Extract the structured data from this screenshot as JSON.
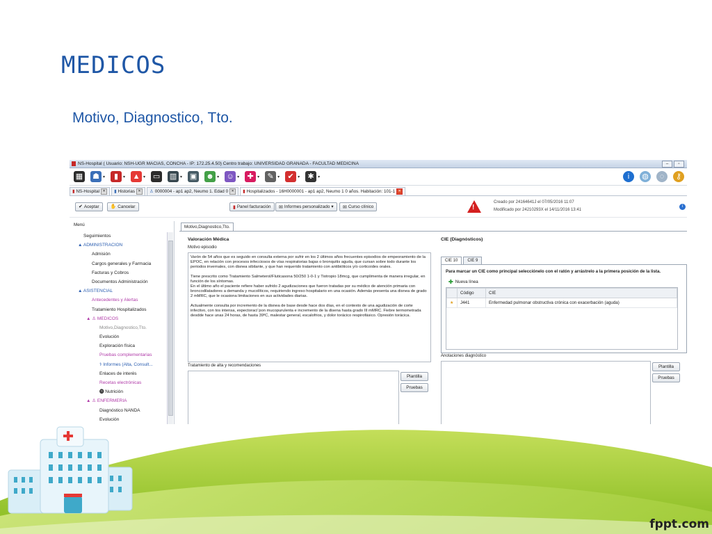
{
  "slide": {
    "title": "MEDICOS",
    "subtitle": "Motivo, Diagnostico, Tto.",
    "footer_logo": "fppt.com"
  },
  "window": {
    "title": "NS-Hospital  ( Usuario: NSH-UGR MACIAS, CONCHA - IP: 172.25.4.50)     Centro trabajo: UNIVERSIDAD GRANADA - FACULTAD MEDICINA",
    "buttons": [
      "‒",
      "▫"
    ]
  },
  "toolbar": {
    "icons": [
      {
        "name": "calendar-icon",
        "glyph": "▦",
        "color": "#2b2b2b"
      },
      {
        "name": "patients-icon",
        "glyph": "☗",
        "color": "#3a6fb8"
      },
      {
        "name": "briefcase-icon",
        "glyph": "▮",
        "color": "#c62828"
      },
      {
        "name": "alarm-icon",
        "glyph": "▲",
        "color": "#e53935"
      },
      {
        "name": "bed-icon",
        "glyph": "▭",
        "color": "#2b2b2b"
      },
      {
        "name": "lab-icon",
        "glyph": "▥",
        "color": "#37474f"
      },
      {
        "name": "hospital-icon",
        "glyph": "▣",
        "color": "#455a64"
      },
      {
        "name": "doctor-icon",
        "glyph": "☻",
        "color": "#43a047"
      },
      {
        "name": "nurse-icon",
        "glyph": "☺",
        "color": "#7e57c2"
      },
      {
        "name": "pharmacy-icon",
        "glyph": "✚",
        "color": "#d81b60"
      },
      {
        "name": "pen-icon",
        "glyph": "✎",
        "color": "#616161"
      },
      {
        "name": "check-icon",
        "glyph": "✔",
        "color": "#d32f2f"
      },
      {
        "name": "settings-icon",
        "glyph": "✱",
        "color": "#333333"
      }
    ],
    "right_icons": [
      {
        "name": "info-icon",
        "glyph": "i",
        "color": "#1e6fd0"
      },
      {
        "name": "search-icon",
        "glyph": "◍",
        "color": "#7fb0d8"
      },
      {
        "name": "chat-icon",
        "glyph": "◌",
        "color": "#a0b4c8"
      },
      {
        "name": "key-icon",
        "glyph": "⚷",
        "color": "#e0a020"
      }
    ]
  },
  "tabs": [
    {
      "label": "NS-Hospital",
      "active": false
    },
    {
      "label": "Historias",
      "active": false
    },
    {
      "label": "0000004 - ap1 ap2, Neumo 1. Edad 0",
      "active": false
    },
    {
      "label": "Hospitalizados - 16H0000001 - ap1 ap2, Neumo 1 0 años. Habitación: 101-1",
      "active": true
    }
  ],
  "actions": {
    "accept": "Aceptar",
    "cancel": "Cancelar",
    "billing": "Panel facturación",
    "reports": "Informes personalizado",
    "course": "Curso clínico",
    "created": "Creado por 24164641J el 07/05/2016 11:07",
    "modified": "Modificado por 24210293X el 14/11/2016 13:41"
  },
  "sidebar": {
    "label": "Menú",
    "items": [
      {
        "label": "Seguimientos",
        "level": "l0",
        "style": ""
      },
      {
        "label": "▲ ADMINISTRACION",
        "level": "l0g",
        "style": "blue"
      },
      {
        "label": "Admisión",
        "level": "l1",
        "style": ""
      },
      {
        "label": "Cargos generales y Farmacia",
        "level": "l1",
        "style": ""
      },
      {
        "label": "Facturas y Cobros",
        "level": "l1",
        "style": ""
      },
      {
        "label": "Documentos Administración",
        "level": "l1",
        "style": ""
      },
      {
        "label": "▲ ASISTENCIAL",
        "level": "l0g",
        "style": "blue"
      },
      {
        "label": "Antecedentes y Alertas",
        "level": "l1",
        "style": "magenta"
      },
      {
        "label": "Tratamiento Hospitalizados",
        "level": "l1",
        "style": ""
      },
      {
        "label": "▲ ♙ MEDICOS",
        "level": "l1g",
        "style": "magenta"
      },
      {
        "label": "Motivo,Diagnostico,Tto.",
        "level": "l2",
        "style": "grey"
      },
      {
        "label": "Evolución",
        "level": "l2",
        "style": ""
      },
      {
        "label": "Exploración física",
        "level": "l2",
        "style": ""
      },
      {
        "label": "Pruebas complementarias",
        "level": "l2",
        "style": "magenta"
      },
      {
        "label": "⚕ Informes (Alta, Consult...",
        "level": "l2",
        "style": "blue"
      },
      {
        "label": "Enlaces de interés",
        "level": "l2",
        "style": ""
      },
      {
        "label": "Recetas electrónicas",
        "level": "l2",
        "style": "magenta"
      },
      {
        "label": "⓫ Nutrición",
        "level": "l2",
        "style": ""
      },
      {
        "label": "▲ ♙ ENFERMERIA",
        "level": "l1g",
        "style": "magenta"
      },
      {
        "label": "Diagnóstico NANDA",
        "level": "l2",
        "style": ""
      },
      {
        "label": "Evolución",
        "level": "l2",
        "style": ""
      }
    ]
  },
  "content": {
    "tab": "Motivo,Diagnostico,Tto.",
    "valoracion_title": "Valoración Médica",
    "motivo_label": "Motivo episodio",
    "motivo_paragraphs": [
      "Varón de 54 años que es seguido en consulta externa por sufrir en los 2 últimos años frecuentes episodios de empeoramiento de la EPOC, en relación con procesos infecciosos de vías respiratorias bajas o bronquitis aguda, que cursan sobre todo durante los periodos invernales, con disnea sibilante, y que han requerido tratamiento con antibióticos y/o corticoides orales.",
      "Tiene prescrito como Tratamiento Salmeterol/Fluticasona 50/250 1-0-1 y Tiotropio 18mcg, que cumplimenta de manera irregular, en función de los síntomas.\nEn el último año el paciente refiere haber sufrido 2 agudizaciones que fueron tratadas por su médico de atención primaria con broncodilatadores a demanda y mucolíticos, requiriendo ingreso hospitalario en una ocasión. Además presenta una disnea de grado 2 mMRC, que le ocasiona limitaciones en sus actividades diarias.",
      "Actualmente consulta por incremento de la disnea de base desde hace dos días, en el contexto de una agudización de corte infectivo, con tos intensa, expectoraci¨pon mucopurulenta e incremento de la disena hasta grado III mMRC. Fiebre termometrada desdde hace unas 24 horas, de hasta 39ºC, malestar general, escalofrios, y dolor torácico respirofásico. Opresión torácica."
    ],
    "tratamiento_label": "Tratamiento de alta y recomendaciones",
    "plantilla": "Plantilla",
    "pruebas": "Pruebas",
    "cie_title": "CIE (Diagnósticos)",
    "cie_tabs": [
      "CIE 10",
      "CIE 9"
    ],
    "cie_instruction": "Para marcar un CIE como principal selecciónelo con el ratón y arrástrelo a la primera posición de la lista.",
    "nueva_linea": "Nueva línea",
    "grid_headers": [
      "Código",
      "CIE"
    ],
    "grid_rows": [
      {
        "code": "J441",
        "desc": "Enfermedad pulmonar obstructiva crónica con exacerbación (aguda)"
      }
    ],
    "anotaciones_label": "Anotaciones diagnóstico"
  }
}
